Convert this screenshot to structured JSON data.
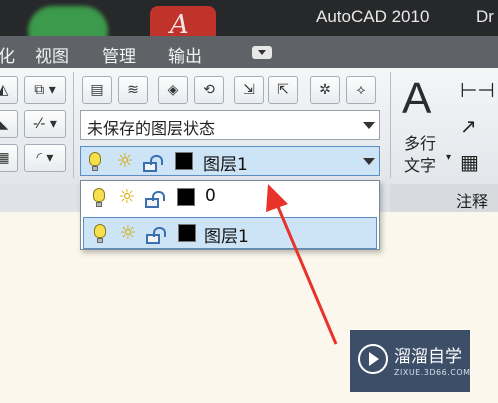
{
  "window": {
    "title": "AutoCAD 2010",
    "title_overflow": "Dr"
  },
  "menu": {
    "items": [
      {
        "label": "化"
      },
      {
        "label": "视图"
      },
      {
        "label": "管理"
      },
      {
        "label": "输出"
      }
    ]
  },
  "ribbon": {
    "layer_state_combo": {
      "value": "未保存的图层状态"
    },
    "layer_combo": {
      "value": "图层1"
    },
    "annotation_panel": {
      "multiline_text_line1": "多行",
      "multiline_text_line2": "文字",
      "big_letter": "A",
      "panel_label": "注释"
    }
  },
  "layer_dropdown": {
    "items": [
      {
        "name": "0",
        "selected": false
      },
      {
        "name": "图层1",
        "selected": true
      }
    ]
  },
  "watermark": {
    "title": "溜溜自学",
    "subtitle": "ZIXUE.3D66.COM"
  },
  "colors": {
    "accent": "#cde4f7",
    "annotation_arrow": "#e8322a",
    "layer_color": "#000000"
  }
}
